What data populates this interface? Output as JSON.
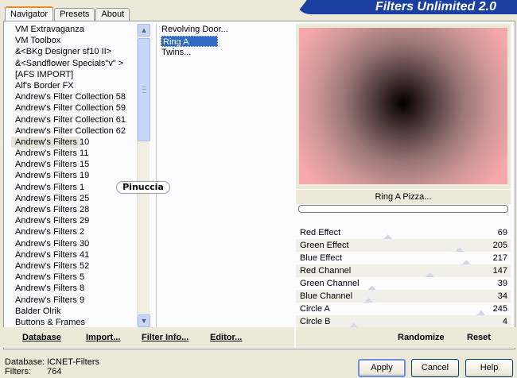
{
  "tabs": [
    "Navigator",
    "Presets",
    "About"
  ],
  "banner_title": "Filters Unlimited 2.0",
  "categories": [
    "VM Extravaganza",
    "VM Toolbox",
    "&<BKg Designer sf10 II>",
    "&<Sandflower Specials\"v\" >",
    "[AFS IMPORT]",
    "Alf's Border FX",
    "Andrew's Filter Collection 58",
    "Andrew's Filter Collection 59",
    "Andrew's Filter Collection 61",
    "Andrew's Filter Collection 62",
    "Andrew's Filters 10",
    "Andrew's Filters 11",
    "Andrew's Filters 15",
    "Andrew's Filters 19",
    "Andrew's Filters 1",
    "Andrew's Filters 25",
    "Andrew's Filters 28",
    "Andrew's Filters 29",
    "Andrew's Filters 2",
    "Andrew's Filters 30",
    "Andrew's Filters 41",
    "Andrew's Filters 52",
    "Andrew's Filters 5",
    "Andrew's Filters 8",
    "Andrew's Filters 9",
    "Balder Olrik",
    "Buttons & Frames"
  ],
  "selected_category": "Andrew's Filters 10",
  "filters": [
    "Revolving Door...",
    "Ring A Pizza...",
    "Twins..."
  ],
  "selected_filter": "Ring A Pizza...",
  "watermark": "Pinuccia",
  "preview_caption": "Ring A Pizza...",
  "controls": [
    {
      "label": "Red Effect",
      "value": "69",
      "level": 0.27
    },
    {
      "label": "Green Effect",
      "value": "205",
      "level": 0.8
    },
    {
      "label": "Blue Effect",
      "value": "217",
      "level": 0.85
    },
    {
      "label": "Red Channel",
      "value": "147",
      "level": 0.58
    },
    {
      "label": "Green Channel",
      "value": "39",
      "level": 0.15
    },
    {
      "label": "Blue Channel",
      "value": "34",
      "level": 0.13
    },
    {
      "label": "Circle A",
      "value": "245",
      "level": 0.96
    },
    {
      "label": "Circle B",
      "value": "4",
      "level": 0.02
    }
  ],
  "left_buttons": [
    "Database",
    "Import...",
    "Filter Info...",
    "Editor..."
  ],
  "right_buttons": [
    "Randomize",
    "Reset"
  ],
  "footer": {
    "database_label": "Database:",
    "database_value": "ICNET-Filters",
    "filters_label": "Filters:",
    "filters_value": "764"
  },
  "dialog_buttons": [
    "Apply",
    "Cancel",
    "Help"
  ]
}
